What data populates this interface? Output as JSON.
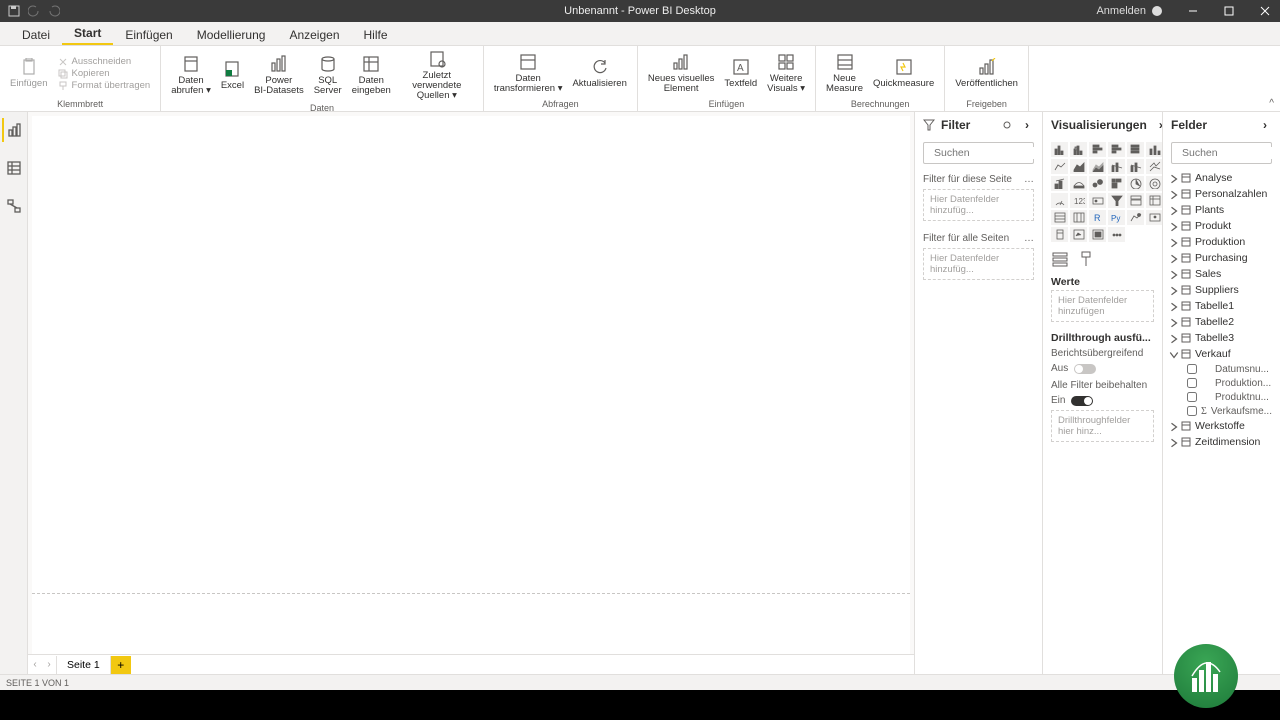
{
  "title": "Unbenannt - Power BI Desktop",
  "titlebar": {
    "signin": "Anmelden"
  },
  "menu": [
    "Datei",
    "Start",
    "Einfügen",
    "Modellierung",
    "Anzeigen",
    "Hilfe"
  ],
  "menu_active": 1,
  "ribbon": {
    "groups": [
      {
        "label": "Klemmbrett",
        "paste": "Einfügen",
        "small": [
          "Ausschneiden",
          "Kopieren",
          "Format übertragen"
        ]
      },
      {
        "label": "Daten",
        "buttons": [
          "Daten\nabrufen ▾",
          "Excel",
          "Power\nBI-Datasets",
          "SQL\nServer",
          "Daten\neingeben",
          "Zuletzt verwendete\nQuellen ▾"
        ]
      },
      {
        "label": "Abfragen",
        "buttons": [
          "Daten\ntransformieren ▾",
          "Aktualisieren"
        ]
      },
      {
        "label": "Einfügen",
        "buttons": [
          "Neues visuelles\nElement",
          "Textfeld",
          "Weitere\nVisuals ▾"
        ]
      },
      {
        "label": "Berechnungen",
        "buttons": [
          "Neue\nMeasure",
          "Quickmeasure"
        ]
      },
      {
        "label": "Freigeben",
        "buttons": [
          "Veröffentlichen"
        ]
      }
    ]
  },
  "views": {
    "tooltip": "Bericht"
  },
  "filter": {
    "title": "Filter",
    "search": "Suchen",
    "section_page": "Filter für diese Seite",
    "section_all": "Filter für alle Seiten",
    "drop_hint": "Hier Datenfelder hinzufüg..."
  },
  "viz": {
    "title": "Visualisierungen",
    "values": "Werte",
    "values_hint": "Hier Datenfelder hinzufügen",
    "drill_title": "Drillthrough ausfü...",
    "cross": "Berichtsübergreifend",
    "off": "Aus",
    "keepall": "Alle Filter beibehalten",
    "on": "Ein",
    "drill_hint": "Drillthroughfelder hier hinz..."
  },
  "fields": {
    "title": "Felder",
    "search": "Suchen",
    "tables": [
      "Analyse",
      "Personalzahlen",
      "Plants",
      "Produkt",
      "Produktion",
      "Purchasing",
      "Sales",
      "Suppliers",
      "Tabelle1",
      "Tabelle2",
      "Tabelle3",
      "Verkauf",
      "Werkstoffe",
      "Zeitdimension"
    ],
    "verkauf_children": [
      "Datumsnu...",
      "Produktion...",
      "Produktnu...",
      "Verkaufsme..."
    ]
  },
  "page_tab": "Seite 1",
  "statusbar": "SEITE 1 VON 1"
}
